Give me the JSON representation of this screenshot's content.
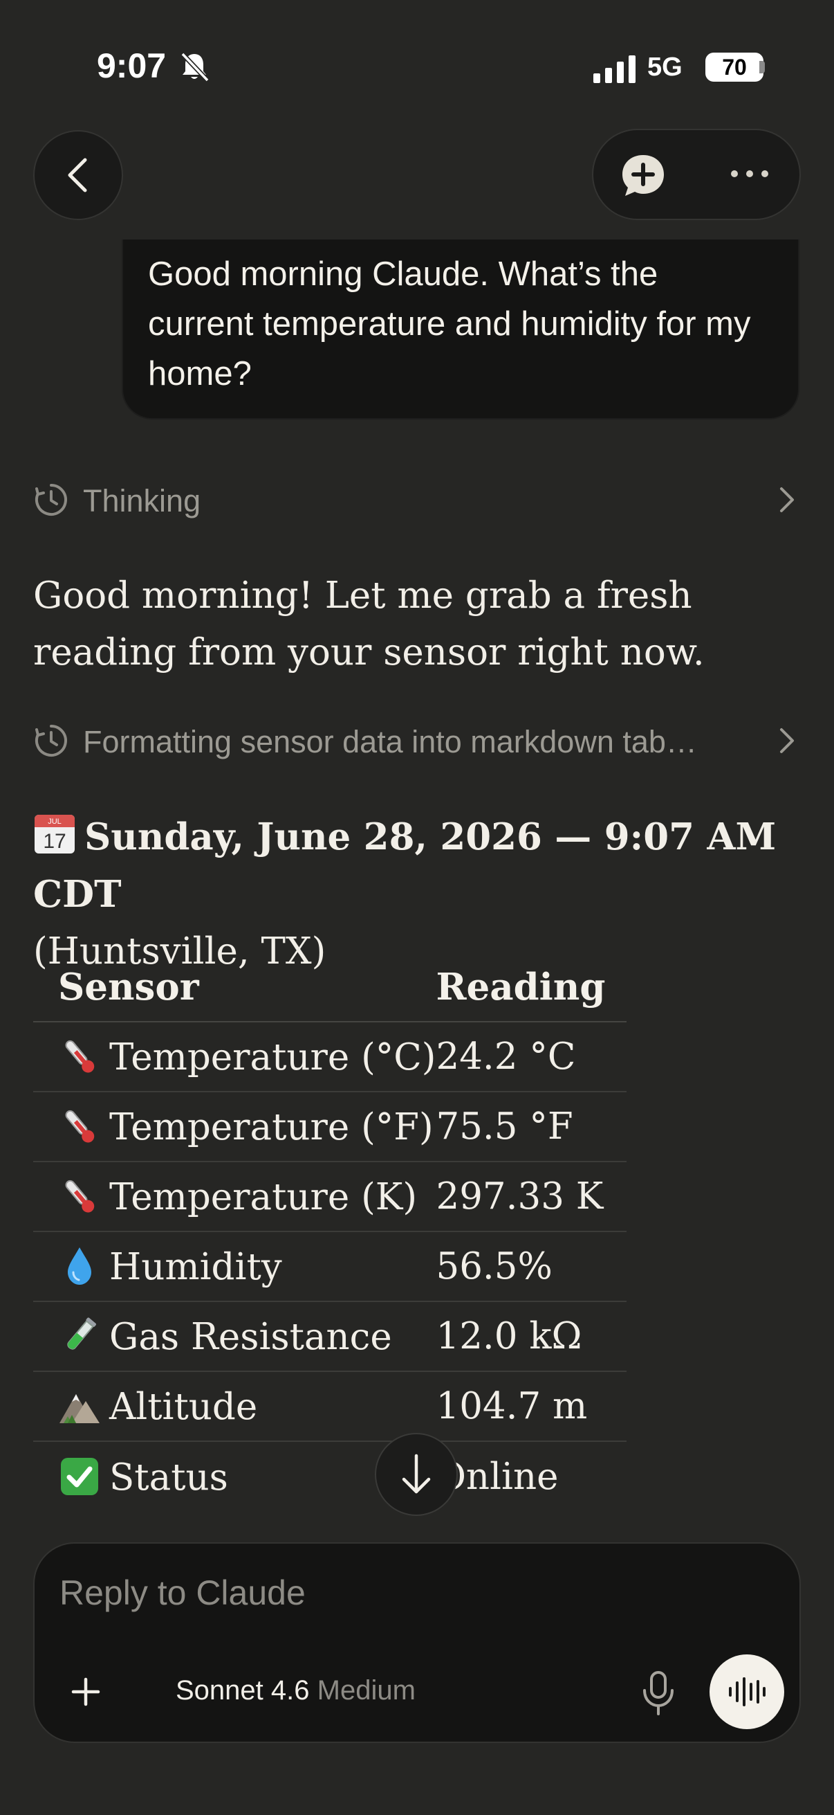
{
  "status_bar": {
    "time": "9:07",
    "network": "5G",
    "battery": "70"
  },
  "nav": {
    "back_icon": "chevron-left-icon",
    "new_chat_icon": "new-chat-plus-icon",
    "more_icon": "more-dots-icon"
  },
  "conversation": {
    "user_message": "Good morning Claude.  What’s the current temperature and humidity for my home?",
    "thinking_label": "Thinking",
    "assistant_intro": "Good morning! Let me grab a fresh reading from your sensor right now.",
    "tool_step_label": "Formatting sensor data into markdown tab…",
    "date_heading": "Sunday, June 28, 2026 — 9:07 AM CDT",
    "location": "(Huntsville, TX)"
  },
  "table": {
    "headers": [
      "Sensor",
      "Reading"
    ],
    "rows": [
      {
        "icon": "thermometer-icon",
        "sensor": "Temperature (°C)",
        "reading": "24.2 °C"
      },
      {
        "icon": "thermometer-icon",
        "sensor": "Temperature (°F)",
        "reading": "75.5 °F"
      },
      {
        "icon": "thermometer-icon",
        "sensor": "Temperature (K)",
        "reading": "297.33 K"
      },
      {
        "icon": "droplet-icon",
        "sensor": "Humidity",
        "reading": "56.5%"
      },
      {
        "icon": "test-tube-icon",
        "sensor": "Gas Resistance",
        "reading": "12.0 kΩ"
      },
      {
        "icon": "mountain-icon",
        "sensor": "Altitude",
        "reading": "104.7 m"
      },
      {
        "icon": "check-box-icon",
        "sensor": "Status",
        "reading": "Online"
      }
    ]
  },
  "composer": {
    "placeholder": "Reply to Claude",
    "model": "Sonnet 4.6",
    "effort": "Medium"
  },
  "colors": {
    "background": "#262624",
    "bubble": "#141413",
    "muted_text": "#9c9a93",
    "check_green": "#3aa845"
  }
}
